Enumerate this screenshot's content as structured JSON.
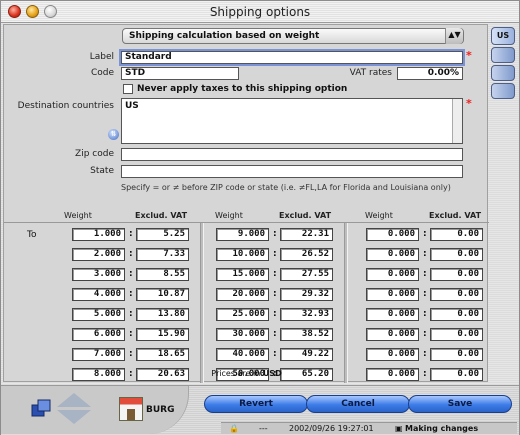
{
  "window": {
    "title": "Shipping options"
  },
  "method_popup": {
    "value": "Shipping calculation based on weight"
  },
  "form": {
    "label_label": "Label",
    "label_value": "Standard",
    "code_label": "Code",
    "code_value": "STD",
    "vat_rates_label": "VAT rates",
    "vat_rates_value": "0.00%",
    "no_tax_checkbox_label": "Never apply taxes to this shipping option",
    "no_tax_checked": false,
    "destination_label": "Destination countries",
    "destination_value": "US",
    "zip_label": "Zip code",
    "zip_value": "",
    "state_label": "State",
    "state_value": "",
    "note": "Specify = or ≠ before ZIP code or state (i.e. ≠FL,LA for Florida and Louisiana only)"
  },
  "rates": {
    "to_label": "To",
    "weight_header": "Weight",
    "vat_header": "Exclud. VAT",
    "columns": [
      {
        "rows": [
          {
            "weight": "1.000",
            "price": "5.25"
          },
          {
            "weight": "2.000",
            "price": "7.33"
          },
          {
            "weight": "3.000",
            "price": "8.55"
          },
          {
            "weight": "4.000",
            "price": "10.87"
          },
          {
            "weight": "5.000",
            "price": "13.80"
          },
          {
            "weight": "6.000",
            "price": "15.90"
          },
          {
            "weight": "7.000",
            "price": "18.65"
          },
          {
            "weight": "8.000",
            "price": "20.63"
          }
        ]
      },
      {
        "rows": [
          {
            "weight": "9.000",
            "price": "22.31"
          },
          {
            "weight": "10.000",
            "price": "26.52"
          },
          {
            "weight": "15.000",
            "price": "27.55"
          },
          {
            "weight": "20.000",
            "price": "29.32"
          },
          {
            "weight": "25.000",
            "price": "32.93"
          },
          {
            "weight": "30.000",
            "price": "38.52"
          },
          {
            "weight": "40.000",
            "price": "49.22"
          },
          {
            "weight": "50.000",
            "price": "65.20"
          }
        ]
      },
      {
        "rows": [
          {
            "weight": "0.000",
            "price": "0.00"
          },
          {
            "weight": "0.000",
            "price": "0.00"
          },
          {
            "weight": "0.000",
            "price": "0.00"
          },
          {
            "weight": "0.000",
            "price": "0.00"
          },
          {
            "weight": "0.000",
            "price": "0.00"
          },
          {
            "weight": "0.000",
            "price": "0.00"
          },
          {
            "weight": "0.000",
            "price": "0.00"
          },
          {
            "weight": "0.000",
            "price": "0.00"
          }
        ]
      }
    ],
    "prices_in_prefix": "Prices are in",
    "currency": "USD"
  },
  "sidebar": {
    "tab_label": "US"
  },
  "footer": {
    "store_label": "BURG",
    "revert_label": "Revert",
    "cancel_label": "Cancel",
    "save_label": "Save",
    "status_left": "---",
    "status_timestamp": "2002/09/26  19:27:01",
    "status_message": "Making changes"
  },
  "colors": {
    "button_blue": "#3d7ce8",
    "required_mark": "#ee2222",
    "focus_ring": "#7a93d6"
  }
}
